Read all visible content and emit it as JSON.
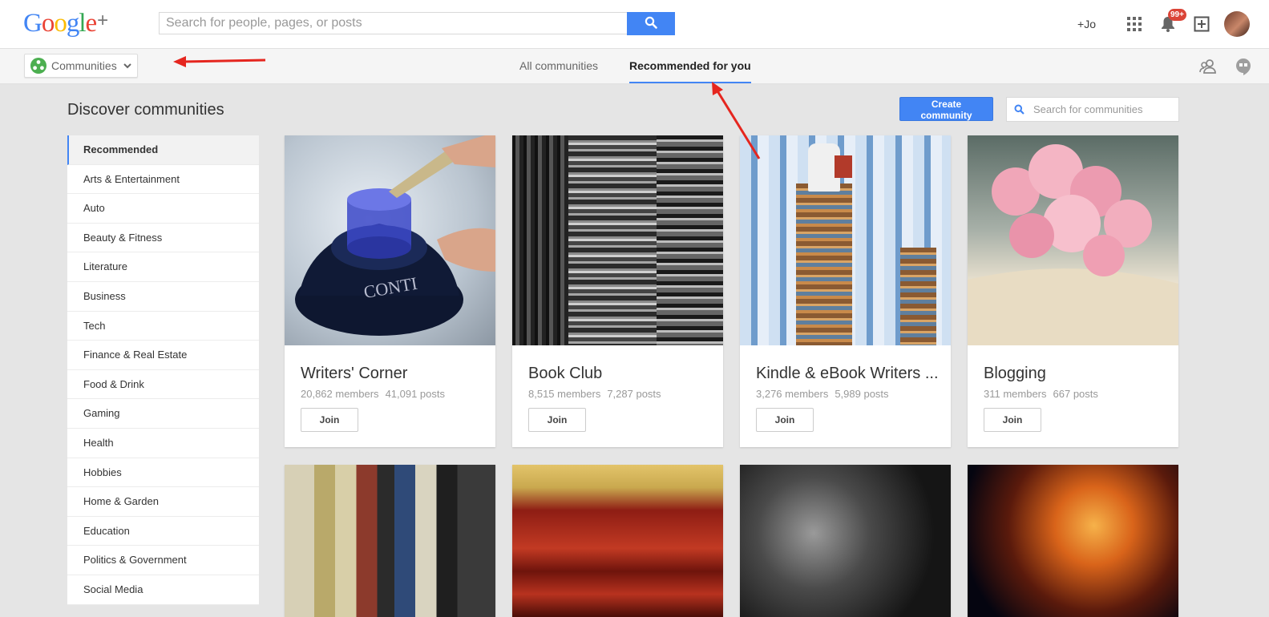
{
  "header": {
    "logo_text": "Google",
    "logo_plus": "+",
    "search_placeholder": "Search for people, pages, or posts",
    "profile_link": "+Jo",
    "notification_count": "99+",
    "icons": [
      "search-icon",
      "apps-grid-icon",
      "bell-icon",
      "share-box-icon",
      "avatar"
    ]
  },
  "subnav": {
    "dropdown_label": "Communities",
    "tabs": [
      {
        "label": "All communities",
        "active": false
      },
      {
        "label": "Recommended for you",
        "active": true
      }
    ],
    "right_icons": [
      "people-icon",
      "hangouts-icon"
    ]
  },
  "page": {
    "title": "Discover communities",
    "create_button": "Create community",
    "community_search_placeholder": "Search for communities"
  },
  "sidebar": {
    "items": [
      {
        "label": "Recommended",
        "active": true
      },
      {
        "label": "Arts & Entertainment"
      },
      {
        "label": "Auto"
      },
      {
        "label": "Beauty & Fitness"
      },
      {
        "label": "Literature"
      },
      {
        "label": "Business"
      },
      {
        "label": "Tech"
      },
      {
        "label": "Finance & Real Estate"
      },
      {
        "label": "Food & Drink"
      },
      {
        "label": "Gaming"
      },
      {
        "label": "Health"
      },
      {
        "label": "Hobbies"
      },
      {
        "label": "Home & Garden"
      },
      {
        "label": "Education"
      },
      {
        "label": "Politics & Government"
      },
      {
        "label": "Social Media"
      }
    ]
  },
  "communities": [
    {
      "name": "Writers' Corner",
      "members": "20,862 members",
      "posts": "41,091 posts",
      "join": "Join",
      "image": "fountain-pen-inkwell"
    },
    {
      "name": "Book Club",
      "members": "8,515 members",
      "posts": "7,287 posts",
      "join": "Join",
      "image": "book-stacks-bw"
    },
    {
      "name": "Kindle & eBook Writers ...",
      "members": "3,276 members",
      "posts": "5,989 posts",
      "join": "Join",
      "image": "man-reading-on-books"
    },
    {
      "name": "Blogging",
      "members": "311 members",
      "posts": "667 posts",
      "join": "Join",
      "image": "pink-flowers-on-book"
    }
  ],
  "communities_row2": [
    {
      "image": "bookshelf-spines"
    },
    {
      "image": "red-books"
    },
    {
      "image": "ereader-and-lamp"
    },
    {
      "image": "space-nebula"
    }
  ],
  "colors": {
    "accent": "#4285f4",
    "annotation": "#e5261f",
    "badge": "#db4437"
  }
}
